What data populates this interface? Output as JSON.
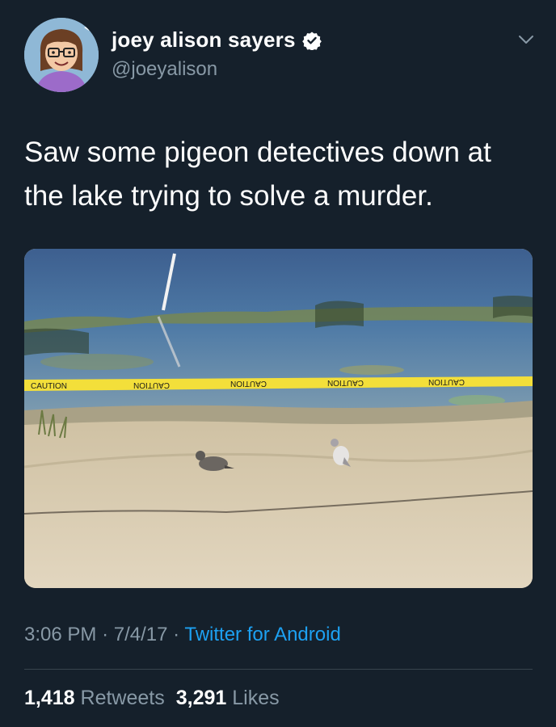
{
  "author": {
    "display_name": "joey alison sayers",
    "handle": "@joeyalison",
    "verified": true,
    "avatar_icon": "cartoon-avatar-icon"
  },
  "tweet": {
    "text": "Saw some pigeon detectives down at the lake trying to solve a murder.",
    "media": {
      "tape_text": "CAUTION"
    }
  },
  "meta": {
    "time": "3:06 PM",
    "separator": "·",
    "date": "7/4/17",
    "source": "Twitter for Android"
  },
  "stats": {
    "retweets_count": "1,418",
    "retweets_label": "Retweets",
    "likes_count": "3,291",
    "likes_label": "Likes"
  },
  "colors": {
    "background": "#15202b",
    "text_primary": "#ffffff",
    "text_secondary": "#8899a6",
    "link": "#1da1f2",
    "verified_badge": "#ffffff"
  },
  "icons": {
    "verified": "verified-badge-icon",
    "menu": "chevron-down-icon"
  }
}
